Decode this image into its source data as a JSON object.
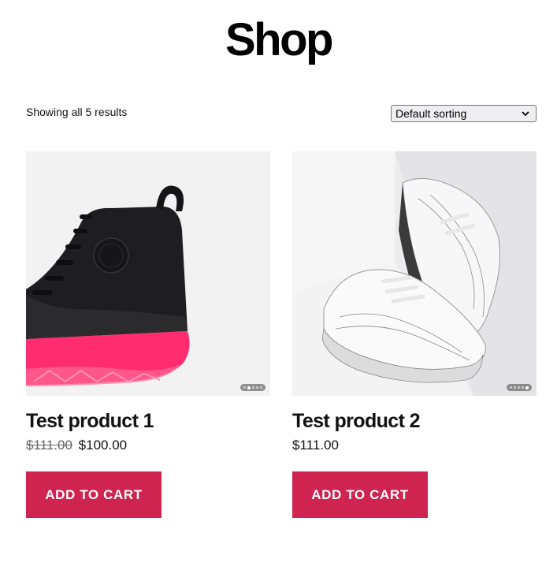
{
  "page": {
    "title": "Shop"
  },
  "toolbar": {
    "result_count": "Showing all 5 results",
    "ordering": {
      "selected": "Default sorting"
    }
  },
  "products": [
    {
      "title": "Test product 1",
      "regular_price": "$111.00",
      "sale_price": "$100.00",
      "button_label": "ADD TO CART",
      "gallery": {
        "count": 5,
        "active_index": 1
      }
    },
    {
      "title": "Test product 2",
      "price": "$111.00",
      "button_label": "ADD TO CART",
      "gallery": {
        "count": 5,
        "active_index": 4
      }
    }
  ],
  "colors": {
    "button_bg": "#cf2350",
    "button_text": "#ffffff",
    "accent_sole": "#ff2d6f"
  },
  "icons": {
    "ordering": "chevron-down-icon"
  }
}
